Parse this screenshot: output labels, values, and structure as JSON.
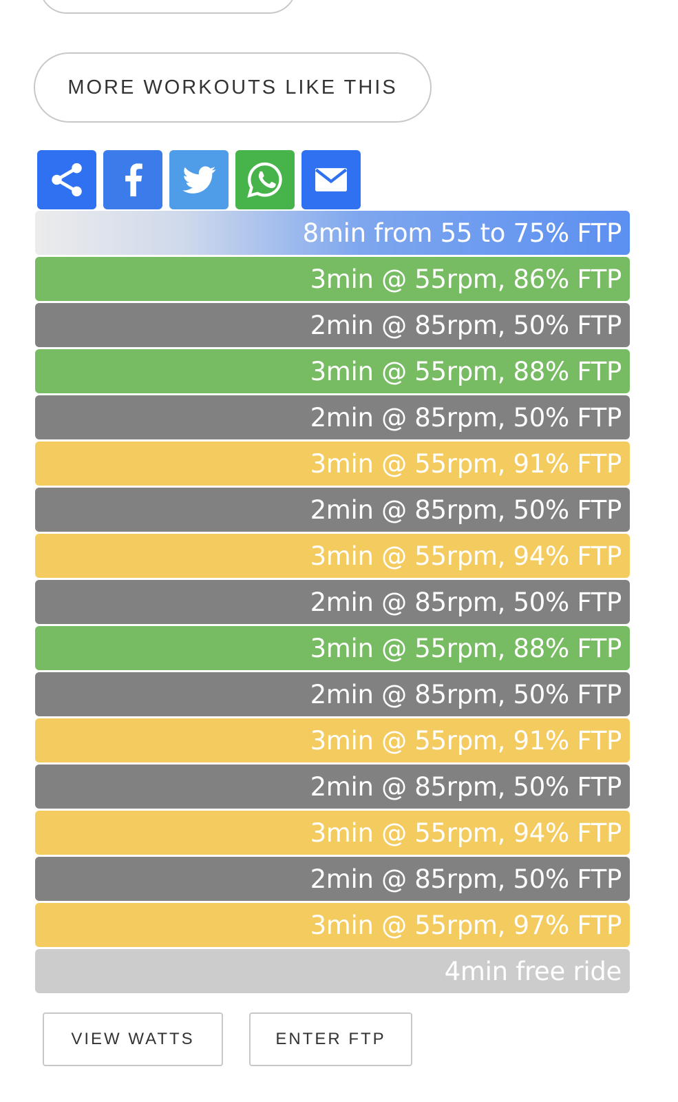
{
  "more_button_label": "MORE WORKOUTS LIKE THIS",
  "share_buttons": [
    {
      "name": "share",
      "color": "#2f71f0"
    },
    {
      "name": "facebook",
      "color": "#3b7bea"
    },
    {
      "name": "twitter",
      "color": "#4f9ce8"
    },
    {
      "name": "whatsapp",
      "color": "#47b34b"
    },
    {
      "name": "email",
      "color": "#2f71f0"
    }
  ],
  "colors": {
    "recovery": "#818181",
    "green": "#77bb62",
    "yellow": "#f3cb5e",
    "free": "#cccccc",
    "warmup_end": "#5b8ff1"
  },
  "steps": [
    {
      "text": "8min from 55 to 75% FTP",
      "zone": "warm"
    },
    {
      "text": "3min @ 55rpm, 86% FTP",
      "zone": "green"
    },
    {
      "text": "2min @ 85rpm, 50% FTP",
      "zone": "recovery"
    },
    {
      "text": "3min @ 55rpm, 88% FTP",
      "zone": "green"
    },
    {
      "text": "2min @ 85rpm, 50% FTP",
      "zone": "recovery"
    },
    {
      "text": "3min @ 55rpm, 91% FTP",
      "zone": "yellow"
    },
    {
      "text": "2min @ 85rpm, 50% FTP",
      "zone": "recovery"
    },
    {
      "text": "3min @ 55rpm, 94% FTP",
      "zone": "yellow"
    },
    {
      "text": "2min @ 85rpm, 50% FTP",
      "zone": "recovery"
    },
    {
      "text": "3min @ 55rpm, 88% FTP",
      "zone": "green"
    },
    {
      "text": "2min @ 85rpm, 50% FTP",
      "zone": "recovery"
    },
    {
      "text": "3min @ 55rpm, 91% FTP",
      "zone": "yellow"
    },
    {
      "text": "2min @ 85rpm, 50% FTP",
      "zone": "recovery"
    },
    {
      "text": "3min @ 55rpm, 94% FTP",
      "zone": "yellow"
    },
    {
      "text": "2min @ 85rpm, 50% FTP",
      "zone": "recovery"
    },
    {
      "text": "3min @ 55rpm, 97% FTP",
      "zone": "yellow"
    },
    {
      "text": "4min free ride",
      "zone": "free"
    }
  ],
  "view_watts_label": "VIEW WATTS",
  "enter_ftp_label": "ENTER FTP"
}
